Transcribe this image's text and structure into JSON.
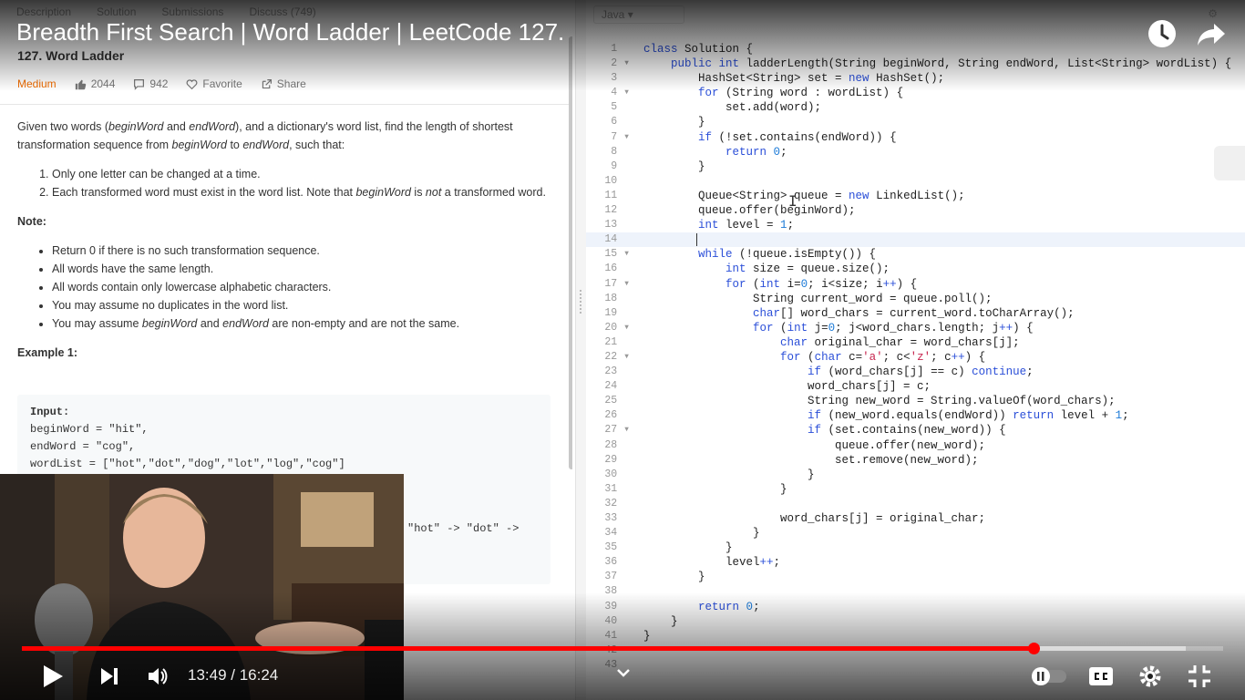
{
  "problem": {
    "tabs": [
      "Description",
      "Solution",
      "Submissions",
      "Discuss (749)"
    ],
    "title": "127. Word Ladder",
    "difficulty": "Medium",
    "likes": "2044",
    "dislikes": "942",
    "favorite": "Favorite",
    "share": "Share",
    "intro_1": "Given two words (",
    "intro_begin": "beginWord",
    "intro_2": " and ",
    "intro_end": "endWord",
    "intro_3": "), and a dictionary's word list, find the length of shortest transformation sequence from ",
    "intro_begin2": "beginWord",
    "intro_4": " to ",
    "intro_end2": "endWord",
    "intro_5": ", such that:",
    "rule_1": "Only one letter can be changed at a time.",
    "rule_2a": "Each transformed word must exist in the word list. Note that ",
    "rule_2b": "beginWord",
    "rule_2c": " is ",
    "rule_2d": "not",
    "rule_2e": " a transformed word.",
    "note_label": "Note:",
    "note_1": "Return 0 if there is no such transformation sequence.",
    "note_2": "All words have the same length.",
    "note_3": "All words contain only lowercase alphabetic characters.",
    "note_4": "You may assume no duplicates in the word list.",
    "note_5a": "You may assume ",
    "note_5b": "beginWord",
    "note_5c": " and ",
    "note_5d": "endWord",
    "note_5e": " are non-empty and are not the same.",
    "example_label": "Example 1:",
    "example_input_label": "Input:",
    "example_line_1": "beginWord = \"hit\",",
    "example_line_2": "endWord = \"cog\",",
    "example_line_3": "wordList = [\"hot\",\"dot\",\"dog\",\"lot\",\"log\",\"cog\"]",
    "example_tail": "\"hot\" -> \"dot\" ->"
  },
  "editor": {
    "language": "Java",
    "code_lines": [
      "class Solution {",
      "    public int ladderLength(String beginWord, String endWord, List<String> wordList) {",
      "        HashSet<String> set = new HashSet();",
      "        for (String word : wordList) {",
      "            set.add(word);",
      "        }",
      "        if (!set.contains(endWord)) {",
      "            return 0;",
      "        }",
      "",
      "        Queue<String> queue = new LinkedList();",
      "        queue.offer(beginWord);",
      "        int level = 1;",
      "",
      "        while (!queue.isEmpty()) {",
      "            int size = queue.size();",
      "            for (int i=0; i<size; i++) {",
      "                String current_word = queue.poll();",
      "                char[] word_chars = current_word.toCharArray();",
      "                for (int j=0; j<word_chars.length; j++) {",
      "                    char original_char = word_chars[j];",
      "                    for (char c='a'; c<'z'; c++) {",
      "                        if (word_chars[j] == c) continue;",
      "                        word_chars[j] = c;",
      "                        String new_word = String.valueOf(word_chars);",
      "                        if (new_word.equals(endWord)) return level + 1;",
      "                        if (set.contains(new_word)) {",
      "                            queue.offer(new_word);",
      "                            set.remove(new_word);",
      "                        }",
      "                    }",
      "",
      "                    word_chars[j] = original_char;",
      "                }",
      "            }",
      "            level++;",
      "        }",
      "",
      "        return 0;",
      "    }",
      "}",
      "",
      ""
    ],
    "fold_lines": [
      2,
      4,
      7,
      15,
      17,
      20,
      22,
      27
    ],
    "active_line": 14
  },
  "player": {
    "video_title": "Breadth First Search | Word Ladder | LeetCode 127.",
    "time_display": "13:49 / 16:24",
    "played_fraction": 0.842,
    "buffered_fraction": 0.969,
    "accent_color": "#ff0000"
  }
}
